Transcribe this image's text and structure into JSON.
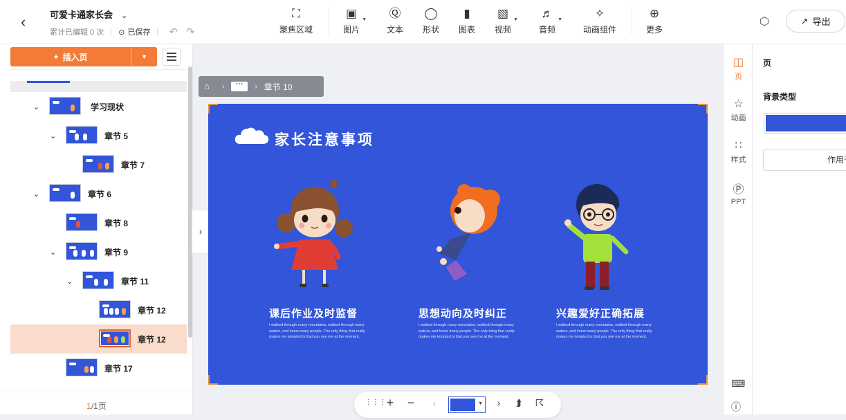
{
  "header": {
    "doc_title": "可爱卡通家长会",
    "edit_count": "累计已编辑 0 次",
    "save_status": "已保存",
    "export_label": "导出"
  },
  "toolbar": [
    {
      "label": "聚焦区域",
      "icon": "focus-icon",
      "dropdown": false
    },
    {
      "label": "图片",
      "icon": "image-icon",
      "dropdown": true
    },
    {
      "label": "文本",
      "icon": "text-icon",
      "dropdown": false
    },
    {
      "label": "形状",
      "icon": "shape-icon",
      "dropdown": false
    },
    {
      "label": "图表",
      "icon": "chart-icon",
      "dropdown": false
    },
    {
      "label": "视频",
      "icon": "video-icon",
      "dropdown": true
    },
    {
      "label": "音频",
      "icon": "audio-icon",
      "dropdown": true
    },
    {
      "label": "动画组件",
      "icon": "puzzle-icon",
      "dropdown": false
    },
    {
      "label": "更多",
      "icon": "plus-circle-icon",
      "dropdown": false
    }
  ],
  "left_panel": {
    "insert_label": "插入页",
    "tree": [
      {
        "label": "学习现状",
        "collapse": true,
        "selected": false
      },
      {
        "label": "章节 5",
        "collapse": true,
        "selected": false
      },
      {
        "label": "章节 7",
        "collapse": false,
        "selected": false
      },
      {
        "label": "章节 6",
        "collapse": true,
        "selected": false
      },
      {
        "label": "章节 8",
        "collapse": false,
        "selected": false
      },
      {
        "label": "章节 9",
        "collapse": true,
        "selected": false
      },
      {
        "label": "章节 11",
        "collapse": true,
        "selected": false
      },
      {
        "label": "章节 12",
        "collapse": false,
        "selected": false
      },
      {
        "label": "章节 12",
        "collapse": false,
        "selected": true
      },
      {
        "label": "章节 17",
        "collapse": false,
        "selected": false
      }
    ],
    "page_current": "1",
    "page_total": "/1页"
  },
  "breadcrumb": {
    "current": "章节 10",
    "more": "···"
  },
  "slide": {
    "title": "家长注意事项",
    "items": [
      {
        "caption": "课后作业及时监督",
        "text": "I walked through many mountains, walked through many waters, and knew many people. The only thing that really makes me tempted is that you see me at the moment."
      },
      {
        "caption": "思想动向及时纠正",
        "text": "I walked through many mountains, walked through many waters, and knew many people. The only thing that really makes me tempted is that you see me at the moment."
      },
      {
        "caption": "兴趣爱好正确拓展",
        "text": "I walked through many mountains, walked through many waters, and knew many people. The only thing that really makes me tempted is that you see me at the moment."
      }
    ]
  },
  "right_strip": [
    {
      "label": "页",
      "icon": "page-icon",
      "active": true
    },
    {
      "label": "动画",
      "icon": "star-icon",
      "active": false
    },
    {
      "label": "样式",
      "icon": "grid-icon",
      "active": false
    },
    {
      "label": "PPT",
      "icon": "ppt-icon",
      "active": false
    }
  ],
  "props": {
    "title": "页",
    "bg_type": "背景类型",
    "bg_color": "#3255d9",
    "apply": "作用于"
  },
  "colors": {
    "accent": "#f47b36",
    "slide_bg": "#3255d9"
  }
}
